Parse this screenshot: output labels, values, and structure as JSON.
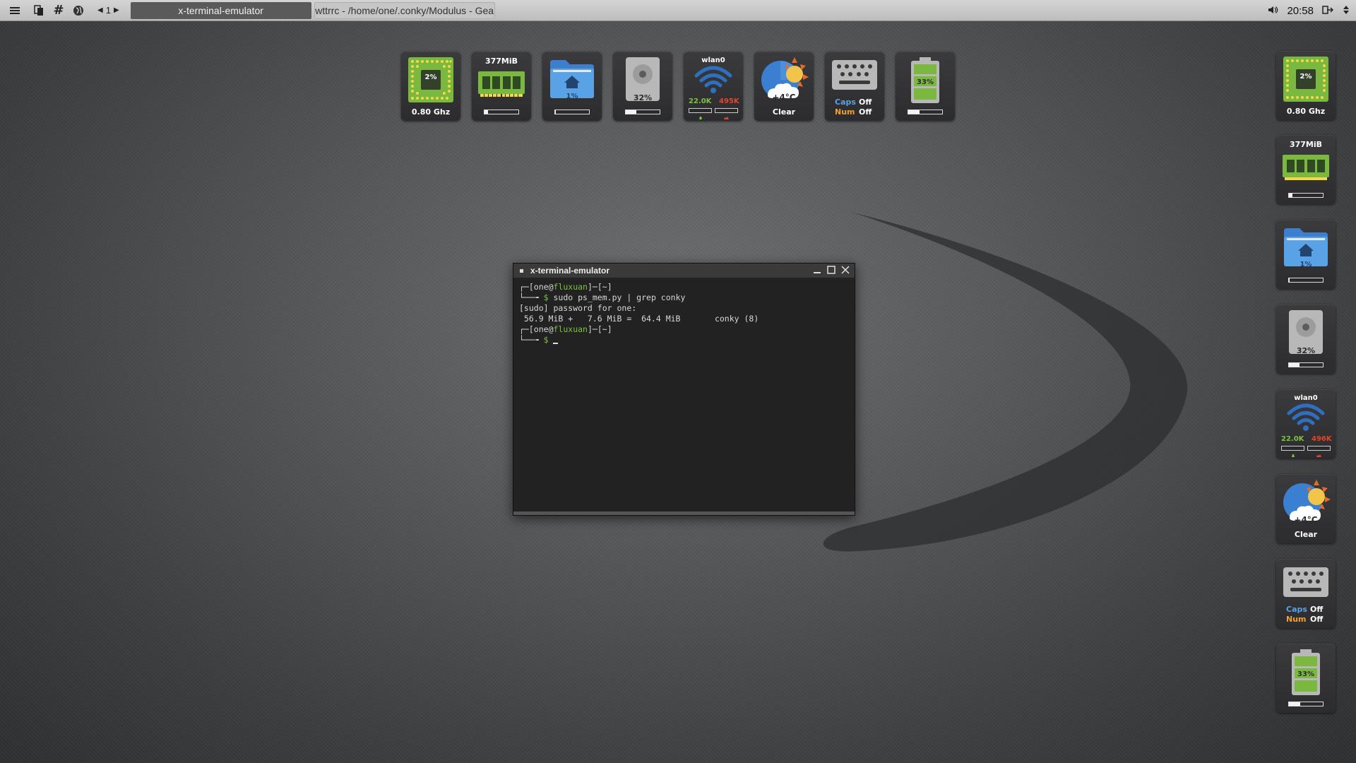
{
  "panel": {
    "desktop_number": "1",
    "tasks": [
      {
        "title": "x-terminal-emulator",
        "active": true
      },
      {
        "title": "wttrrc - /home/one/.conky/Modulus - Gea",
        "active": false
      }
    ],
    "clock": "20:58"
  },
  "widgets": {
    "cpu": {
      "percent": "2%",
      "freq": "0.80 Ghz"
    },
    "memory": {
      "used": "377MiB",
      "usage_fraction": 0.1
    },
    "home": {
      "percent": "1%",
      "usage_fraction": 0.01
    },
    "disk": {
      "percent": "32%",
      "usage_fraction": 0.32
    },
    "network": {
      "interface": "wlan0",
      "top": {
        "down": "22.0K",
        "up": "495K"
      },
      "side": {
        "down": "22.0K",
        "up": "496K"
      }
    },
    "weather": {
      "temp": "+4°C",
      "condition": "Clear"
    },
    "keyboard": {
      "caps_label": "Caps",
      "caps_state": "Off",
      "num_label": "Num",
      "num_state": "Off"
    },
    "battery": {
      "percent": "33%",
      "level_fraction": 0.33
    }
  },
  "terminal": {
    "title": "x-terminal-emulator",
    "user": "one",
    "host": "fluxuan",
    "dir": "~",
    "command1": "sudo ps_mem.py | grep conky",
    "output1": "[sudo] password for one:",
    "output2": " 56.9 MiB +   7.6 MiB =  64.4 MiB       conky (8)"
  },
  "colors": {
    "chip_green": "#7ab83f",
    "folder_blue": "#4a90d9",
    "net_down": "#7cc144",
    "net_up": "#e2452b",
    "caps_blue": "#5aa2e6",
    "num_orange": "#f0a030"
  }
}
